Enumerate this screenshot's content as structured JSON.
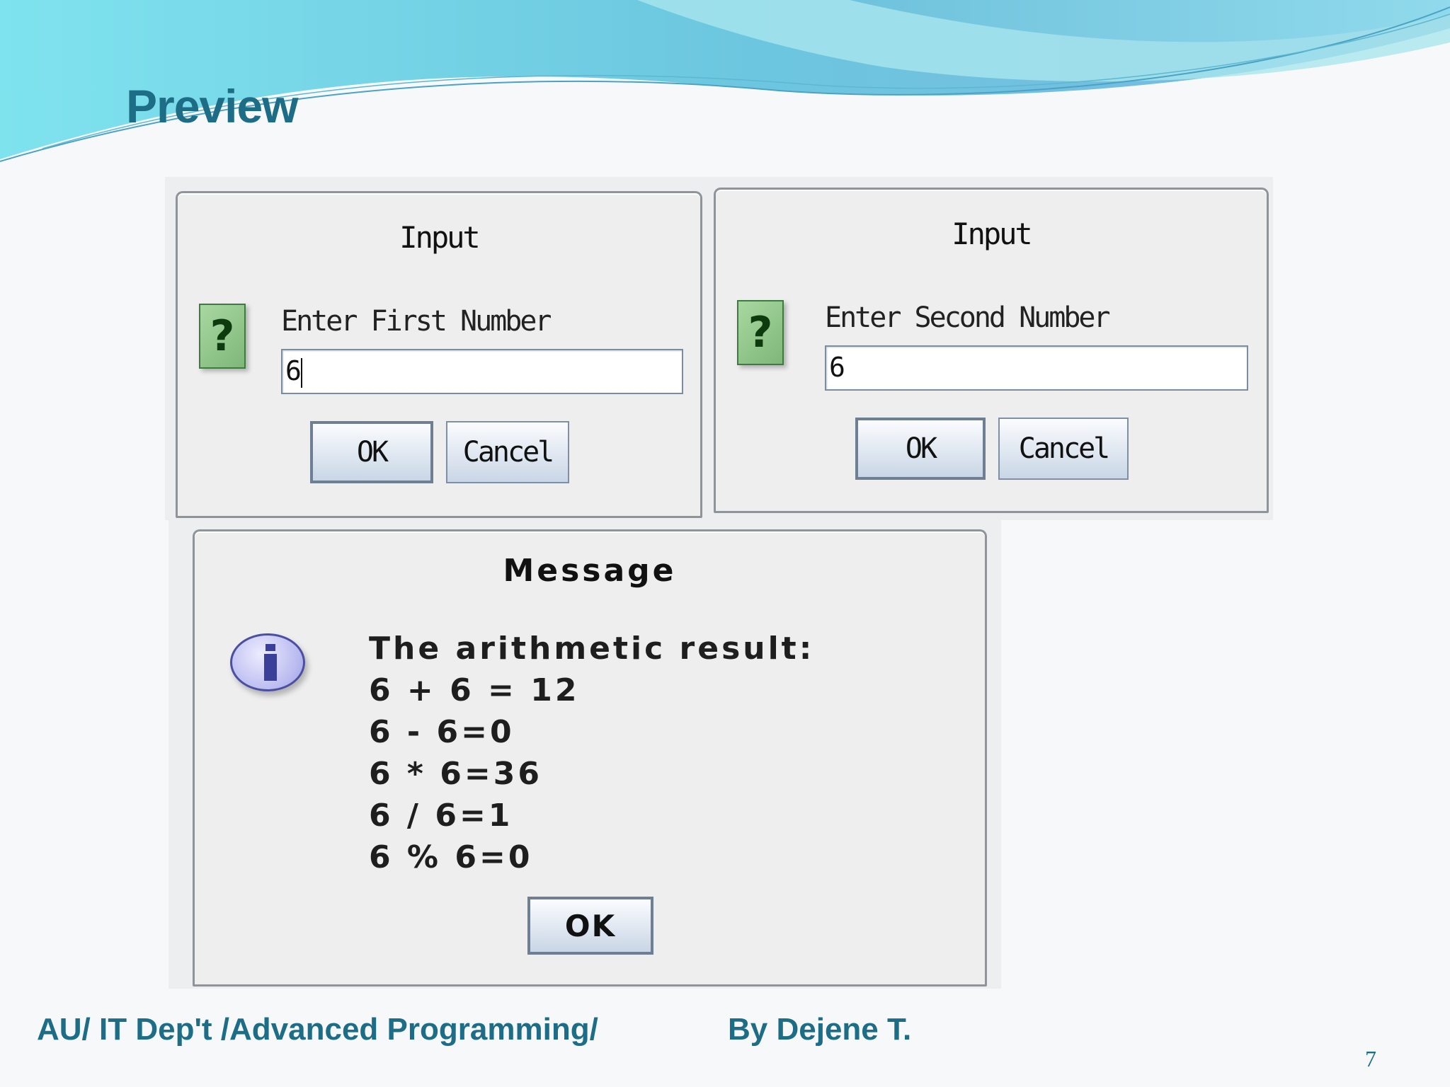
{
  "slide": {
    "title": "Preview",
    "footer_left": "AU/ IT Dep't /Advanced Programming/",
    "footer_right": "By Dejene T.",
    "page_number": "7"
  },
  "dialog_first": {
    "title": "Input",
    "icon": "question-icon",
    "prompt": "Enter First Number",
    "value": "6",
    "ok_label": "OK",
    "cancel_label": "Cancel"
  },
  "dialog_second": {
    "title": "Input",
    "icon": "question-icon",
    "prompt": "Enter Second Number",
    "value": "6",
    "ok_label": "OK",
    "cancel_label": "Cancel"
  },
  "dialog_message": {
    "title": "Message",
    "icon": "info-icon",
    "lines": [
      "The arithmetic result:",
      "6 + 6 = 12",
      "6 - 6=0",
      "6 * 6=36",
      "6 / 6=1",
      "6 % 6=0"
    ],
    "ok_label": "OK"
  },
  "colors": {
    "accent": "#1d6d86",
    "wave_light": "#7fe3ee",
    "wave_dark": "#5aa9d6",
    "question_icon": "#8fca88",
    "info_icon": "#b9b9f0"
  }
}
